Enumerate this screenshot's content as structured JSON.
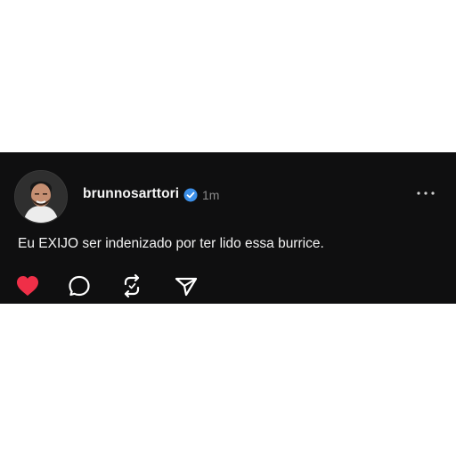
{
  "post": {
    "username": "brunnosarttori",
    "time": "1m",
    "text": "Eu EXIJO ser indenizado por ter lido essa burrice."
  },
  "icons": {
    "more": "more-horizontal-icon",
    "verified": "verified-badge-icon",
    "like": "heart-icon",
    "reply": "comment-icon",
    "repost": "repost-icon",
    "share": "share-send-icon"
  },
  "colors": {
    "background": "#0f0f10",
    "text": "#f3f3f3",
    "muted": "#8a8a8a",
    "verified": "#3c8fe8",
    "like": "#ef2f48"
  }
}
